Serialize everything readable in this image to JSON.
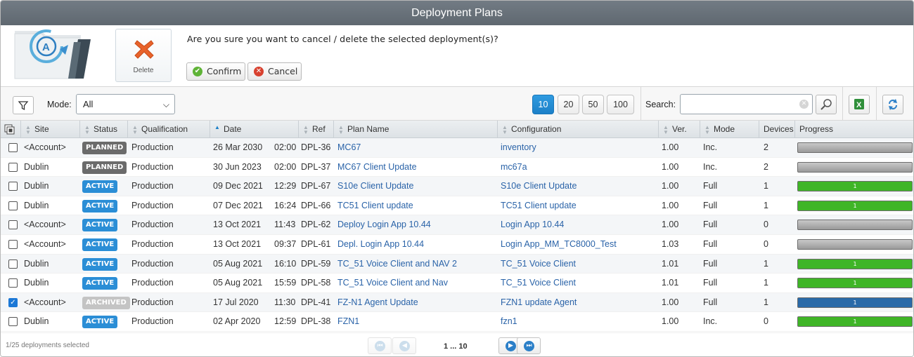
{
  "window": {
    "title": "Deployment Plans"
  },
  "confirm": {
    "delete_label": "Delete",
    "question": "Are you sure you want to cancel / delete the selected deployment(s)?",
    "confirm_label": "Confirm",
    "cancel_label": "Cancel"
  },
  "toolbar": {
    "mode_label": "Mode:",
    "mode_value": "All",
    "page_sizes": [
      "10",
      "20",
      "50",
      "100"
    ],
    "active_page_size": "10",
    "search_label": "Search:",
    "search_value": ""
  },
  "columns": [
    "Site",
    "Status",
    "Qualification",
    "Date",
    "Ref",
    "Plan Name",
    "Configuration",
    "Ver.",
    "Mode",
    "Devices",
    "Progress"
  ],
  "rows": [
    {
      "checked": false,
      "site": "<Account>",
      "status": "PLANNED",
      "qualification": "Production",
      "date": "26 Mar 2030",
      "time": "02:00",
      "ref": "DPL-36",
      "plan": "MC67",
      "config": "inventory",
      "ver": "1.00",
      "mode": "Inc.",
      "devices": "2",
      "progress_label": "",
      "progress_color": "gray"
    },
    {
      "checked": false,
      "site": "Dublin",
      "status": "PLANNED",
      "qualification": "Production",
      "date": "30 Jun 2023",
      "time": "02:00",
      "ref": "DPL-37",
      "plan": "MC67 Client Update",
      "config": "mc67a",
      "ver": "1.00",
      "mode": "Inc.",
      "devices": "2",
      "progress_label": "",
      "progress_color": "gray"
    },
    {
      "checked": false,
      "site": "Dublin",
      "status": "ACTIVE",
      "qualification": "Production",
      "date": "09 Dec 2021",
      "time": "12:29",
      "ref": "DPL-67",
      "plan": "S10e Client Update",
      "config": "S10e Client Update",
      "ver": "1.00",
      "mode": "Full",
      "devices": "1",
      "progress_label": "1",
      "progress_color": "green"
    },
    {
      "checked": false,
      "site": "Dublin",
      "status": "ACTIVE",
      "qualification": "Production",
      "date": "07 Dec 2021",
      "time": "16:24",
      "ref": "DPL-66",
      "plan": "TC51 Client update",
      "config": "TC51 Client update",
      "ver": "1.00",
      "mode": "Full",
      "devices": "1",
      "progress_label": "1",
      "progress_color": "green"
    },
    {
      "checked": false,
      "site": "<Account>",
      "status": "ACTIVE",
      "qualification": "Production",
      "date": "13 Oct 2021",
      "time": "11:43",
      "ref": "DPL-62",
      "plan": "Deploy Login App 10.44",
      "config": "Login App 10.44",
      "ver": "1.00",
      "mode": "Full",
      "devices": "0",
      "progress_label": "",
      "progress_color": "gray"
    },
    {
      "checked": false,
      "site": "<Account>",
      "status": "ACTIVE",
      "qualification": "Production",
      "date": "13 Oct 2021",
      "time": "09:37",
      "ref": "DPL-61",
      "plan": "Depl. Login App 10.44",
      "config": "Login App_MM_TC8000_Test",
      "ver": "1.03",
      "mode": "Full",
      "devices": "0",
      "progress_label": "",
      "progress_color": "gray"
    },
    {
      "checked": false,
      "site": "Dublin",
      "status": "ACTIVE",
      "qualification": "Production",
      "date": "05 Aug 2021",
      "time": "16:10",
      "ref": "DPL-59",
      "plan": "TC_51 Voice Client and NAV 2",
      "config": "TC_51 Voice Client",
      "ver": "1.01",
      "mode": "Full",
      "devices": "1",
      "progress_label": "1",
      "progress_color": "green"
    },
    {
      "checked": false,
      "site": "Dublin",
      "status": "ACTIVE",
      "qualification": "Production",
      "date": "05 Aug 2021",
      "time": "15:59",
      "ref": "DPL-58",
      "plan": "TC_51 Voice Client and Nav",
      "config": "TC_51 Voice Client",
      "ver": "1.01",
      "mode": "Full",
      "devices": "1",
      "progress_label": "1",
      "progress_color": "green"
    },
    {
      "checked": true,
      "site": "<Account>",
      "status": "ARCHIVED",
      "qualification": "Production",
      "date": "17 Jul 2020",
      "time": "11:30",
      "ref": "DPL-41",
      "plan": "FZ-N1 Agent Update",
      "config": "FZN1 update Agent",
      "ver": "1.00",
      "mode": "Full",
      "devices": "1",
      "progress_label": "1",
      "progress_color": "blue"
    },
    {
      "checked": false,
      "site": "Dublin",
      "status": "ACTIVE",
      "qualification": "Production",
      "date": "02 Apr 2020",
      "time": "12:59",
      "ref": "DPL-38",
      "plan": "FZN1",
      "config": "fzn1",
      "ver": "1.00",
      "mode": "Inc.",
      "devices": "0",
      "progress_label": "1",
      "progress_color": "green"
    }
  ],
  "footer": {
    "selected_text": "1/25 deployments selected",
    "pages_text": "1 ... 10"
  },
  "colors": {
    "planned": "#6b6b6b",
    "active": "#2b8ed6",
    "archived": "#c4c4c4",
    "progress_green": "#3fb527",
    "progress_blue": "#2a6aa8",
    "link": "#2a63a8"
  }
}
